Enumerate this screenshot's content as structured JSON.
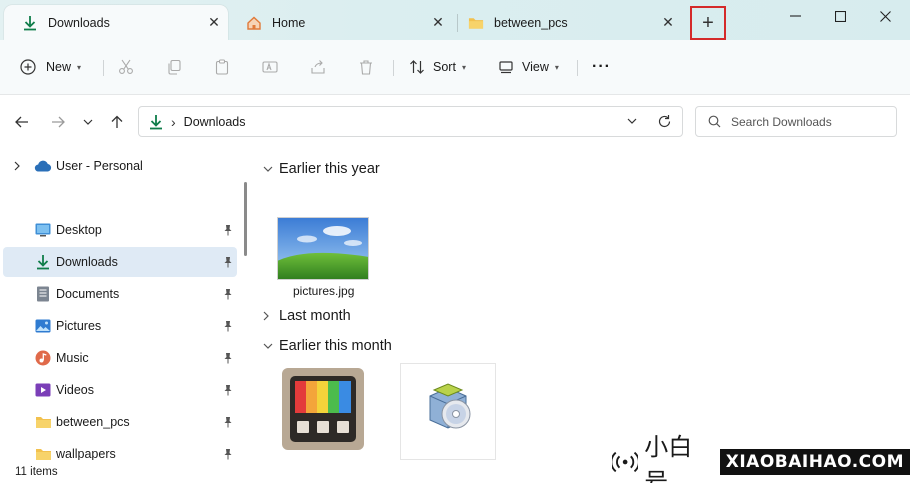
{
  "tabs": [
    {
      "label": "Downloads",
      "icon": "download-icon",
      "active": true
    },
    {
      "label": "Home",
      "icon": "home-icon",
      "active": false
    },
    {
      "label": "between_pcs",
      "icon": "folder-icon",
      "active": false
    }
  ],
  "tab_close_glyph": "✕",
  "new_tab_glyph": "+",
  "window_controls": {
    "minimize": "—",
    "maximize": "☐",
    "close": "✕"
  },
  "commandbar": {
    "new_label": "New",
    "sort_label": "Sort",
    "view_label": "View",
    "more_glyph": "···",
    "chevron_glyph": "▾"
  },
  "address": {
    "breadcrumb_sep": "›",
    "current": "Downloads"
  },
  "search": {
    "placeholder": "Search Downloads"
  },
  "navpane": {
    "top_item": {
      "label": "User - Personal",
      "icon": "cloud-icon"
    },
    "quick_access": [
      {
        "label": "Desktop",
        "icon": "desktop-icon",
        "selected": false
      },
      {
        "label": "Downloads",
        "icon": "download-icon",
        "selected": true
      },
      {
        "label": "Documents",
        "icon": "documents-icon",
        "selected": false
      },
      {
        "label": "Pictures",
        "icon": "pictures-icon",
        "selected": false
      },
      {
        "label": "Music",
        "icon": "music-icon",
        "selected": false
      },
      {
        "label": "Videos",
        "icon": "videos-icon",
        "selected": false
      },
      {
        "label": "between_pcs",
        "icon": "folder-icon",
        "selected": false
      },
      {
        "label": "wallpapers",
        "icon": "folder-icon",
        "selected": false
      }
    ]
  },
  "content": {
    "groups": [
      {
        "label": "Earlier this year",
        "expanded": true
      },
      {
        "label": "Last month",
        "expanded": false
      },
      {
        "label": "Earlier this month",
        "expanded": true
      }
    ],
    "files": [
      {
        "label": "pictures.jpg",
        "icon": "image-thumbnail-icon"
      },
      {
        "label": "",
        "icon": "powertoys-installer-icon"
      },
      {
        "label": "",
        "icon": "setup-disc-icon"
      }
    ]
  },
  "status": {
    "items_count": "11 items"
  },
  "watermark": {
    "cn": "小白号",
    "en": "XIAOBAIHAO.COM"
  },
  "colors": {
    "accent": "#0f7d4a",
    "selection": "#dfeaf5",
    "highlight_box": "#d42a2a",
    "folder": "#f2c14e"
  }
}
